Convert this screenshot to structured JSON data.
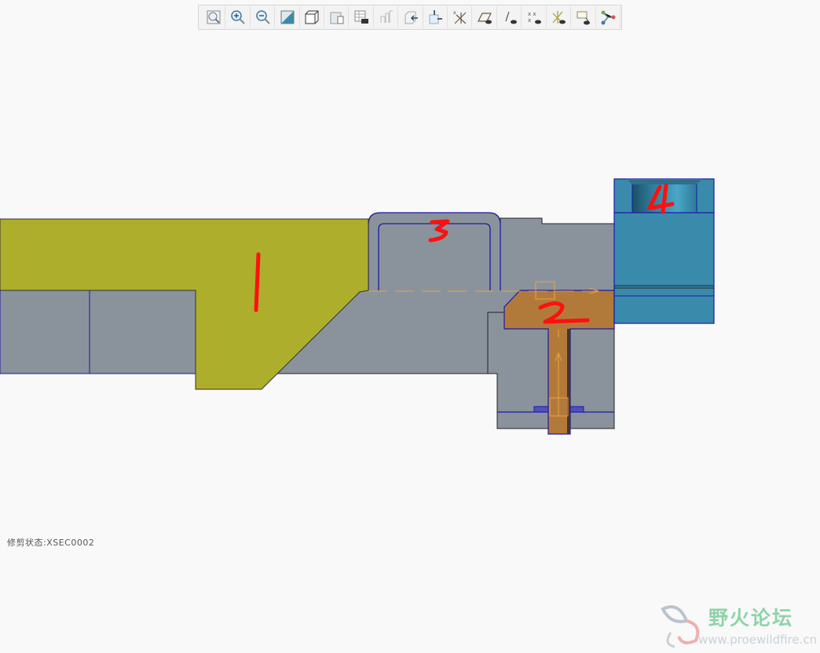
{
  "toolbar": {
    "buttons": [
      {
        "name": "refit-icon"
      },
      {
        "name": "zoom-in-icon"
      },
      {
        "name": "zoom-out-icon"
      },
      {
        "name": "repaint-icon"
      },
      {
        "name": "display-style-icon"
      },
      {
        "name": "saved-orientations-icon"
      },
      {
        "name": "view-manager-icon"
      },
      {
        "name": "perspective-icon"
      },
      {
        "name": "section-icon"
      },
      {
        "name": "placement-icon"
      },
      {
        "name": "datum-display-icon"
      },
      {
        "name": "plane-display-icon"
      },
      {
        "name": "axis-display-icon"
      },
      {
        "name": "point-display-icon"
      },
      {
        "name": "csys-display-icon"
      },
      {
        "name": "annotation-display-icon"
      },
      {
        "name": "spin-center-icon"
      }
    ]
  },
  "viewport": {
    "part_labels": [
      "1",
      "2",
      "3",
      "4"
    ],
    "colors": {
      "part1": "#adae2b",
      "part2": "#b27a3a",
      "part4": "#3a8bab",
      "body": "#8a939b",
      "edge": "#1a1aa6",
      "orange": "#f0a040",
      "red": "#ff1010"
    }
  },
  "status": {
    "text": "修剪状态:XSEC0002"
  },
  "watermark": {
    "title": "野火论坛",
    "url": "www.proewildfire.cn"
  }
}
